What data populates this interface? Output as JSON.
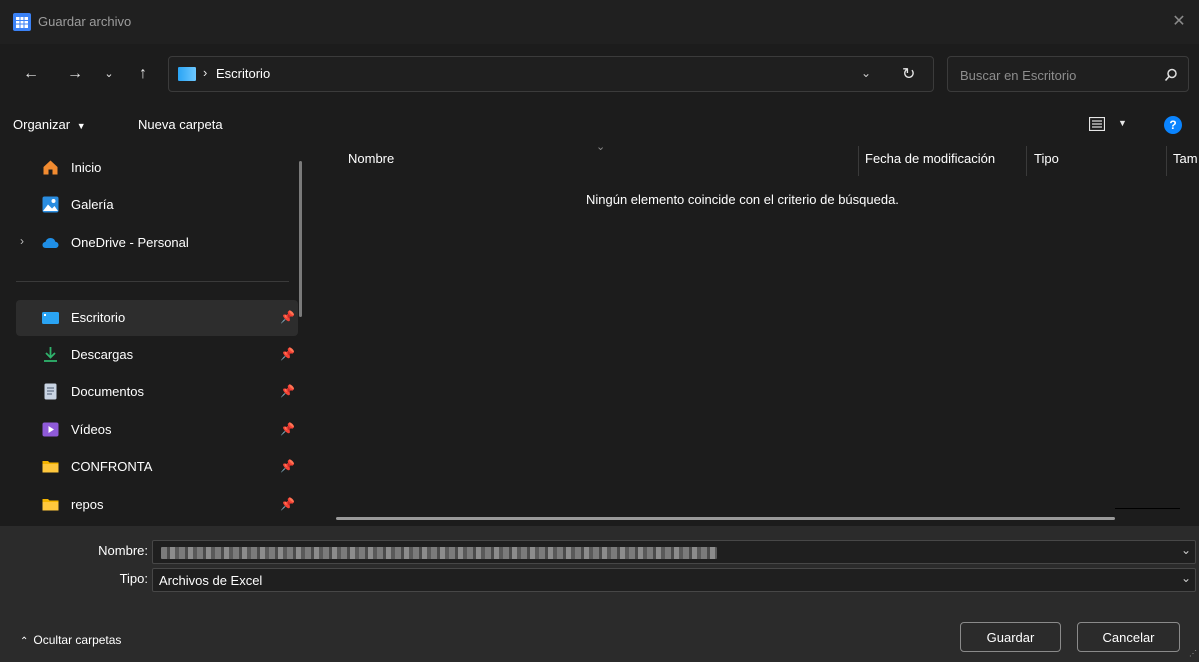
{
  "window": {
    "title": "Guardar archivo",
    "close_icon": "close-icon"
  },
  "nav": {
    "breadcrumb": "Escritorio",
    "breadcrumb_sep": "›"
  },
  "search": {
    "placeholder": "Buscar en Escritorio"
  },
  "toolbar": {
    "organize_label": "Organizar",
    "new_folder_label": "Nueva carpeta"
  },
  "sidebar": {
    "items": [
      {
        "label": "Inicio",
        "icon": "home-icon"
      },
      {
        "label": "Galería",
        "icon": "gallery-icon"
      },
      {
        "label": "OneDrive - Personal",
        "icon": "cloud-icon"
      },
      {
        "label": "Escritorio",
        "icon": "desktop-icon",
        "pinned": true,
        "selected": true
      },
      {
        "label": "Descargas",
        "icon": "download-icon",
        "pinned": true
      },
      {
        "label": "Documentos",
        "icon": "document-icon",
        "pinned": true
      },
      {
        "label": "Vídeos",
        "icon": "video-icon",
        "pinned": true
      },
      {
        "label": "CONFRONTA",
        "icon": "folder-icon",
        "pinned": true
      },
      {
        "label": "repos",
        "icon": "folder-icon",
        "pinned": true
      }
    ]
  },
  "content": {
    "columns": [
      "Nombre",
      "Fecha de modificación",
      "Tipo",
      "Tam"
    ],
    "empty_message": "Ningún elemento coincide con el criterio de búsqueda."
  },
  "form": {
    "name_label": "Nombre:",
    "type_label": "Tipo:",
    "type_value": "Archivos de Excel"
  },
  "footer": {
    "hide_folders_label": "Ocultar carpetas",
    "save_label": "Guardar",
    "cancel_label": "Cancelar"
  },
  "colors": {
    "accent": "#0078d4",
    "background": "#1c1c1c",
    "folder": "#f4b400"
  }
}
